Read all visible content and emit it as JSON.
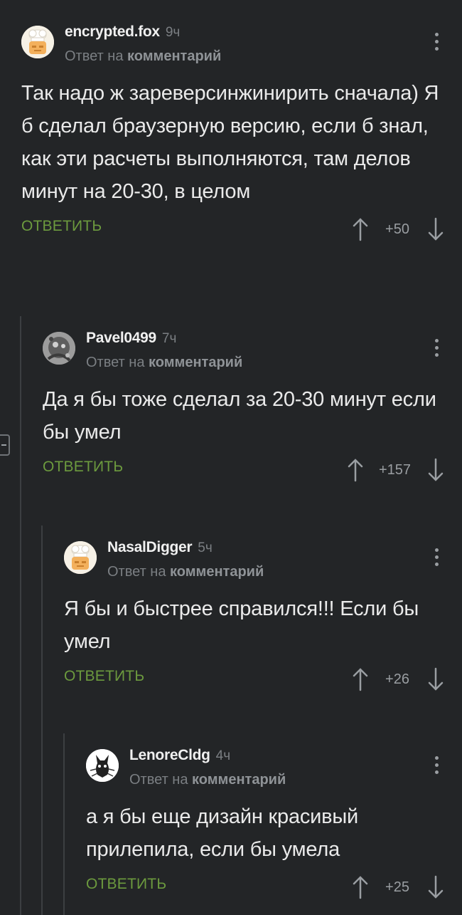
{
  "comments": [
    {
      "author": "encrypted.fox",
      "time": "9ч",
      "reply_prefix": "Ответ на",
      "reply_link": "комментарий",
      "text": "Так надо ж зареверсинжинирить сначала) Я б сделал браузерную версию, если б знал, как эти расчеты выполняются, там делов минут на 20-30, в целом",
      "reply_label": "ОТВЕТИТЬ",
      "score": "+50",
      "avatar": "cook-avatar-icon"
    },
    {
      "author": "Pavel0499",
      "time": "7ч",
      "reply_prefix": "Ответ на",
      "reply_link": "комментарий",
      "text": "Да я бы тоже сделал за 20-30 минут если бы умел",
      "reply_label": "ОТВЕТИТЬ",
      "score": "+157",
      "avatar": "grayscale-photo-avatar-icon"
    },
    {
      "author": "NasalDigger",
      "time": "5ч",
      "reply_prefix": "Ответ на",
      "reply_link": "комментарий",
      "text": "Я бы и быстрее справился!!! Если бы умел",
      "reply_label": "ОТВЕТИТЬ",
      "score": "+26",
      "avatar": "cook-avatar-icon"
    },
    {
      "author": "LenoreCldg",
      "time": "4ч",
      "reply_prefix": "Ответ на",
      "reply_link": "комментарий",
      "text": "а я бы еще дизайн красивый прилепила, если бы умела",
      "reply_label": "ОТВЕТИТЬ",
      "score": "+25",
      "avatar": "drawing-avatar-icon"
    }
  ],
  "colors": {
    "background": "#232527",
    "reply_green": "#6c9a3e",
    "muted": "#7b7f83",
    "thread_line": "#3c3f42"
  }
}
